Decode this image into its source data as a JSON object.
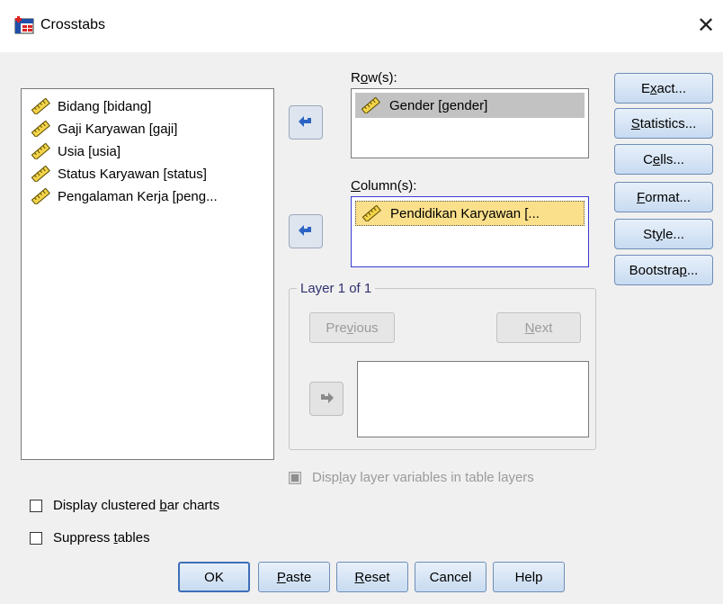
{
  "window": {
    "title": "Crosstabs",
    "close_glyph": "✕"
  },
  "source_variables": [
    {
      "label": "Bidang  [bidang]",
      "icon": "ruler-icon"
    },
    {
      "label": "Gaji Karyawan [gaji]",
      "icon": "ruler-icon"
    },
    {
      "label": "Usia [usia]",
      "icon": "ruler-icon"
    },
    {
      "label": "Status Karyawan [status]",
      "icon": "ruler-icon"
    },
    {
      "label": "Pengalaman Kerja [peng...",
      "icon": "ruler-icon"
    }
  ],
  "rows": {
    "label_pre": "R",
    "label_ul": "o",
    "label_post": "w(s):",
    "items": [
      {
        "label": "Gender [gender]",
        "icon": "ruler-icon",
        "selected": true
      }
    ]
  },
  "columns": {
    "label_pre": "",
    "label_ul": "C",
    "label_post": "olumn(s):",
    "items": [
      {
        "label": "Pendidikan Karyawan [...",
        "icon": "ruler-icon",
        "highlighted": true
      }
    ]
  },
  "layer": {
    "legend": "Layer 1 of 1",
    "previous": {
      "pre": "Pre",
      "ul": "v",
      "post": "ious"
    },
    "next": {
      "pre": "",
      "ul": "N",
      "post": "ext"
    },
    "display_layers": {
      "pre": "Disp",
      "ul": "l",
      "post": "ay layer variables in table layers",
      "checked": false,
      "enabled": false
    }
  },
  "side_buttons": [
    {
      "pre": "E",
      "ul": "x",
      "post": "act..."
    },
    {
      "pre": "",
      "ul": "S",
      "post": "tatistics..."
    },
    {
      "pre": "C",
      "ul": "e",
      "post": "lls..."
    },
    {
      "pre": "",
      "ul": "F",
      "post": "ormat..."
    },
    {
      "pre": "St",
      "ul": "y",
      "post": "le..."
    },
    {
      "pre": "Bootstra",
      "ul": "p",
      "post": "..."
    }
  ],
  "options": {
    "clustered": {
      "pre": "Display clustered ",
      "ul": "b",
      "post": "ar charts",
      "checked": false
    },
    "suppress": {
      "pre": "Suppress ",
      "ul": "t",
      "post": "ables",
      "checked": false
    }
  },
  "bottom_buttons": [
    {
      "pre": "OK",
      "ul": "",
      "post": ""
    },
    {
      "pre": "",
      "ul": "P",
      "post": "aste"
    },
    {
      "pre": "",
      "ul": "R",
      "post": "eset"
    },
    {
      "pre": "Cancel",
      "ul": "",
      "post": ""
    },
    {
      "pre": "Help",
      "ul": "",
      "post": ""
    }
  ],
  "colors": {
    "selected_row_bg": "#c2c2c2",
    "highlight_col_bg": "#fbe08c",
    "active_border": "#3b3bd1",
    "arrow_blue": "#2c63c4"
  }
}
